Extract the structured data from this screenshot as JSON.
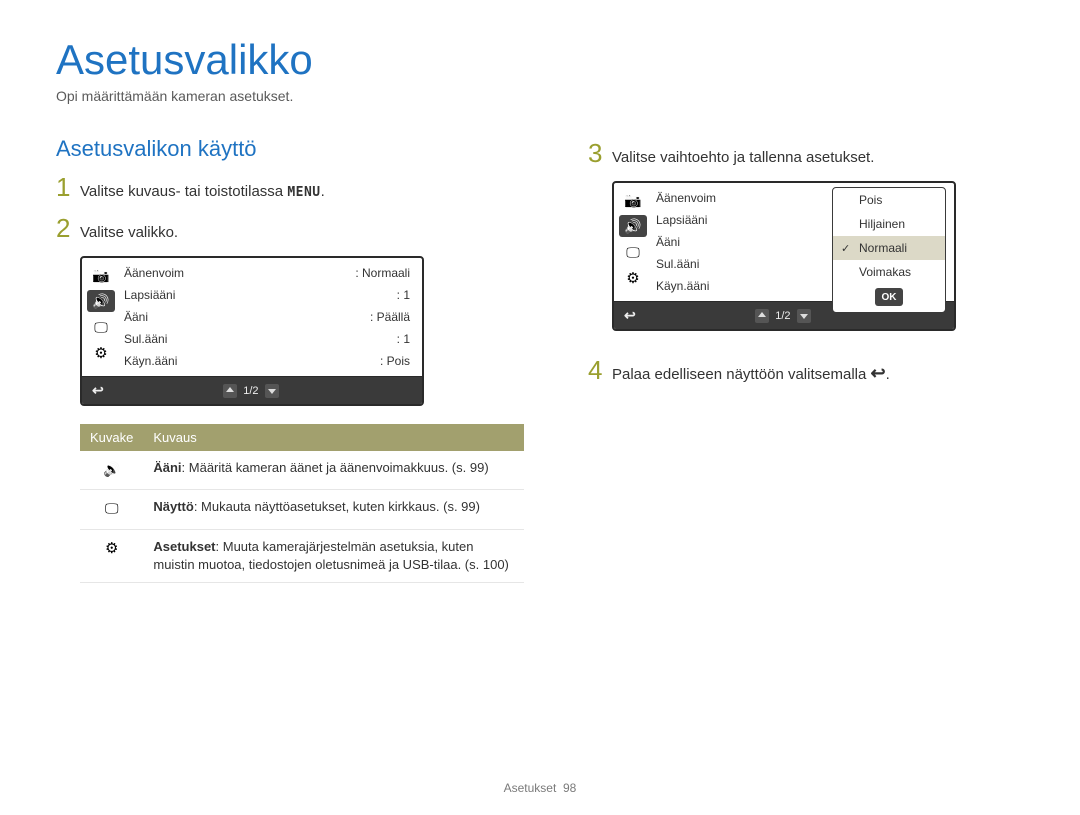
{
  "title": "Asetusvalikko",
  "subtitle": "Opi määrittämään kameran asetukset.",
  "section_heading": "Asetusvalikon käyttö",
  "steps": {
    "s1_text": "Valitse kuvaus- tai toistotilassa ",
    "s1_glyph": "MENU",
    "s1_suffix": ".",
    "s2_text": "Valitse valikko.",
    "s3_text": "Valitse vaihtoehto ja tallenna asetukset.",
    "s4_text": "Palaa edelliseen näyttöön valitsemalla ",
    "s4_glyph": "↩",
    "s4_suffix": "."
  },
  "camscreen_a": {
    "rows": [
      {
        "label": "Äänenvoim",
        "value": ": Normaali"
      },
      {
        "label": "Lapsiääni",
        "value": ": 1"
      },
      {
        "label": "Ääni",
        "value": ": Päällä"
      },
      {
        "label": "Sul.ääni",
        "value": ": 1"
      },
      {
        "label": "Käyn.ääni",
        "value": ": Pois"
      }
    ],
    "page": "1/2",
    "back_glyph": "↩"
  },
  "camscreen_b": {
    "rows": [
      {
        "label": "Äänenvoim"
      },
      {
        "label": "Lapsiääni"
      },
      {
        "label": "Ääni"
      },
      {
        "label": "Sul.ääni"
      },
      {
        "label": "Käyn.ääni"
      }
    ],
    "options": [
      {
        "label": "Pois",
        "selected": false
      },
      {
        "label": "Hiljainen",
        "selected": false
      },
      {
        "label": "Normaali",
        "selected": true
      },
      {
        "label": "Voimakas",
        "selected": false
      }
    ],
    "ok": "OK",
    "page": "1/2",
    "back_glyph": "↩"
  },
  "icon_table": {
    "head_icon": "Kuvake",
    "head_desc": "Kuvaus",
    "rows": [
      {
        "icon": "sound",
        "bold": "Ääni",
        "desc": ": Määritä kameran äänet ja äänenvoimakkuus. (s. 99)"
      },
      {
        "icon": "display",
        "bold": "Näyttö",
        "desc": ": Mukauta näyttöasetukset, kuten kirkkaus. (s. 99)"
      },
      {
        "icon": "gear",
        "bold": "Asetukset",
        "desc": ": Muuta kamerajärjestelmän asetuksia, kuten muistin muotoa, tiedostojen oletusnimeä ja USB-tilaa. (s. 100)"
      }
    ]
  },
  "footer": {
    "label": "Asetukset",
    "page": "98"
  }
}
